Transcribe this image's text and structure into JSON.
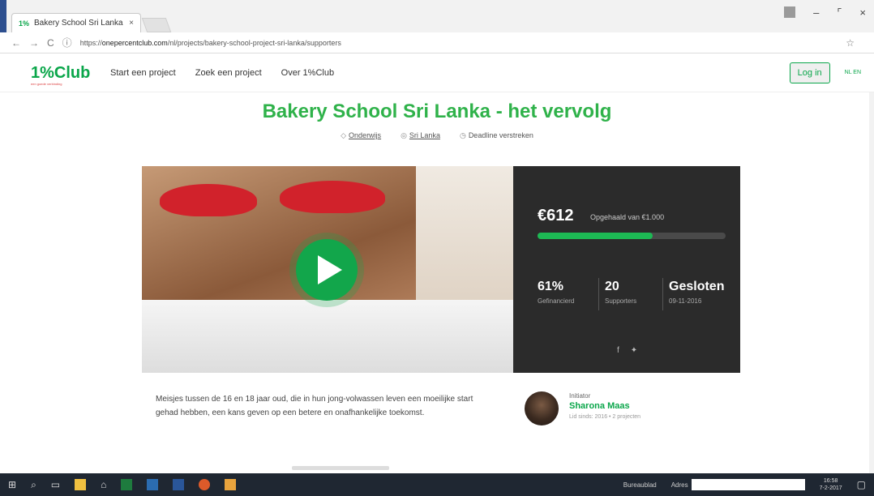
{
  "browser": {
    "tab_title": "Bakery School Sri Lanka",
    "tab_favicon": "1%",
    "url_prefix": "https://",
    "url_domain": "onepercentclub.com",
    "url_path": "/nl/projects/bakery-school-project-sri-lanka/supporters"
  },
  "site": {
    "logo": "1%Club",
    "logo_tagline": "een goede verbinding",
    "nav": [
      "Start een project",
      "Zoek een project",
      "Over 1%Club"
    ],
    "login_label": "Log in",
    "languages": "NL EN"
  },
  "project": {
    "title": "Bakery School Sri Lanka - het vervolg",
    "category": "Onderwijs",
    "country": "Sri Lanka",
    "deadline_status": "Deadline verstreken",
    "description": "Meisjes tussen de 16 en 18 jaar oud, die in hun jong-volwassen leven een moeilijke start gehad hebben, een kans geven op een betere en onafhankelijke toekomst."
  },
  "stats": {
    "amount": "€612",
    "target_text": "Opgehaald van €1.000",
    "progress_fraction": 0.61,
    "funded_value": "61%",
    "funded_label": "Gefinancierd",
    "supporters_value": "20",
    "supporters_label": "Supporters",
    "status_value": "Gesloten",
    "status_date": "09-11-2016"
  },
  "initiator": {
    "label": "Initiator",
    "name": "Sharona Maas",
    "meta": "Lid sinds: 2016 • 2 projecten"
  },
  "taskbar": {
    "bureaublad": "Bureaublad",
    "adres": "Adres",
    "time": "16:58",
    "date": "7-2-2017"
  },
  "colors": {
    "brand_green": "#0aa64a",
    "dark_panel": "#2b2b2b"
  }
}
